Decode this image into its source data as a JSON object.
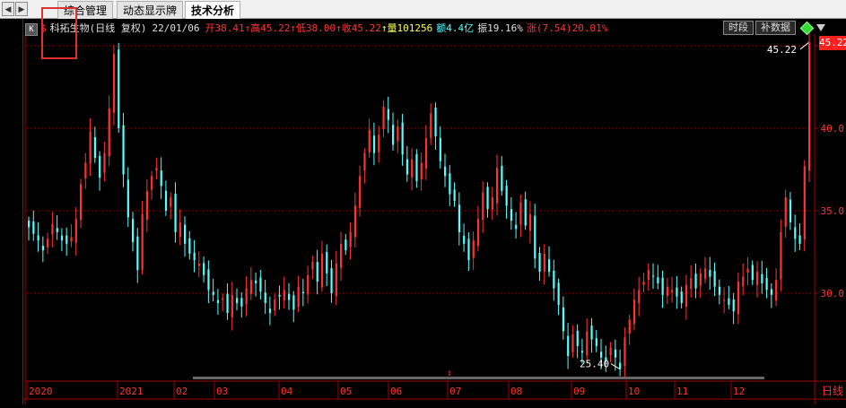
{
  "tabs": {
    "nav_left": "◀",
    "items": [
      {
        "label": "综合管理",
        "active": false
      },
      {
        "label": "动态显示牌",
        "active": false
      },
      {
        "label": "技术分析",
        "active": true
      }
    ]
  },
  "info": {
    "k_icon": "K",
    "currency_icon": "$",
    "stock_name": "科拓生物(日线 复权)",
    "date": "22/01/06",
    "open": "开38.41",
    "high": "↑高45.22",
    "low": "↑低38.00",
    "close": "↑收45.22",
    "volume": "↑量101256",
    "amount": "额4.4亿",
    "amplitude": "振19.16%",
    "change": "涨(7.54)20.01%"
  },
  "buttons": {
    "timeframe": "时段",
    "supplement": "补数据"
  },
  "price_badge": "45.22",
  "annotations": {
    "high_label": "45.22",
    "low_label": "25.40",
    "period_label": "日线"
  },
  "colors": {
    "up": "#ff3232",
    "down": "#54ffff",
    "grid": "#a00000",
    "axis_text": "#ff3232"
  },
  "chart_data": {
    "type": "candlestick",
    "y_ticks": [
      30.0,
      35.0,
      40.0,
      45.0
    ],
    "y_tick_labels": [
      "30.0",
      "35.0",
      "40.0",
      "45.2"
    ],
    "ylim": [
      25.0,
      46.0
    ],
    "x_tick_labels": [
      "2020",
      "2021",
      "02",
      "03",
      "04",
      "05",
      "06",
      "07",
      "08",
      "09",
      "10",
      "11",
      "12"
    ],
    "series": [
      {
        "name": "close",
        "values": [
          34.0,
          33.6,
          33.2,
          32.6,
          33.3,
          34.2,
          33.7,
          33.2,
          33.0,
          33.4,
          34.5,
          36.6,
          37.9,
          39.8,
          38.2,
          37.0,
          38.5,
          41.2,
          44.5,
          40.0,
          37.2,
          34.6,
          33.1,
          31.4,
          34.8,
          36.2,
          37.1,
          37.6,
          36.5,
          35.0,
          35.8,
          33.7,
          34.3,
          33.0,
          32.4,
          32.0,
          31.8,
          31.1,
          30.2,
          29.9,
          29.4,
          29.7,
          28.8,
          29.9,
          29.4,
          29.2,
          30.3,
          30.8,
          30.6,
          30.1,
          29.4,
          28.8,
          29.6,
          29.8,
          30.2,
          29.6,
          29.0,
          30.4,
          30.0,
          31.1,
          31.9,
          30.7,
          32.4,
          31.2,
          30.0,
          31.8,
          33.0,
          32.6,
          33.7,
          35.3,
          37.1,
          38.5,
          39.9,
          38.5,
          39.6,
          41.3,
          40.5,
          39.0,
          40.1,
          38.4,
          37.2,
          38.1,
          36.8,
          37.9,
          39.4,
          40.9,
          39.5,
          38.0,
          37.1,
          36.0,
          35.6,
          33.7,
          33.0,
          32.0,
          33.2,
          34.5,
          36.1,
          35.1,
          35.8,
          37.6,
          36.2,
          35.3,
          34.4,
          33.9,
          35.5,
          34.1,
          34.8,
          32.1,
          31.3,
          32.4,
          31.3,
          30.3,
          29.3,
          27.7,
          26.2,
          27.5,
          26.8,
          26.4,
          27.7,
          27.2,
          26.8,
          26.1,
          25.9,
          26.7,
          26.1,
          25.4,
          27.3,
          28.4,
          29.6,
          30.2,
          30.7,
          31.4,
          31.0,
          30.6,
          29.9,
          30.4,
          30.2,
          29.8,
          29.4,
          30.5,
          30.9,
          30.3,
          31.2,
          31.5,
          31.0,
          30.4,
          29.9,
          29.6,
          29.3,
          28.9,
          30.7,
          31.0,
          31.5,
          30.8,
          31.3,
          30.6,
          30.2,
          29.9,
          30.8,
          33.7,
          35.8,
          34.3,
          33.3,
          33.0,
          37.7,
          45.22
        ]
      }
    ]
  }
}
